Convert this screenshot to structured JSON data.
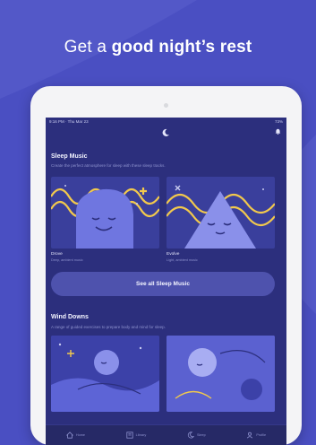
{
  "headline": {
    "prefix": "Get a",
    "bold": "good night’s rest"
  },
  "status_bar": {
    "time": "9:16 PM · Thu Mar 23",
    "battery": "73%"
  },
  "icons": {
    "moon": "moon-icon",
    "bell": "bell-icon"
  },
  "sleep_music": {
    "title": "Sleep Music",
    "subtitle": "Create the perfect atmosphere for sleep with these sleep tracks.",
    "cards": [
      {
        "title": "Drove",
        "subtitle": "Deep, ambient music"
      },
      {
        "title": "Evolve",
        "subtitle": "Light, ambient music"
      }
    ],
    "see_all_label": "See all Sleep Music"
  },
  "wind_downs": {
    "title": "Wind Downs",
    "subtitle": "A range of guided exercises to prepare body and mind for sleep."
  },
  "tabs": [
    {
      "label": "Home",
      "icon": "house-icon"
    },
    {
      "label": "Library",
      "icon": "library-icon"
    },
    {
      "label": "Sleep",
      "icon": "sleep-moon-icon"
    },
    {
      "label": "Profile",
      "icon": "profile-icon"
    }
  ],
  "colors": {
    "background": "#4a4fc2",
    "screen": "#2c2f7d",
    "accent_yellow": "#f2c94c",
    "card_blue": "#5d64d6"
  }
}
